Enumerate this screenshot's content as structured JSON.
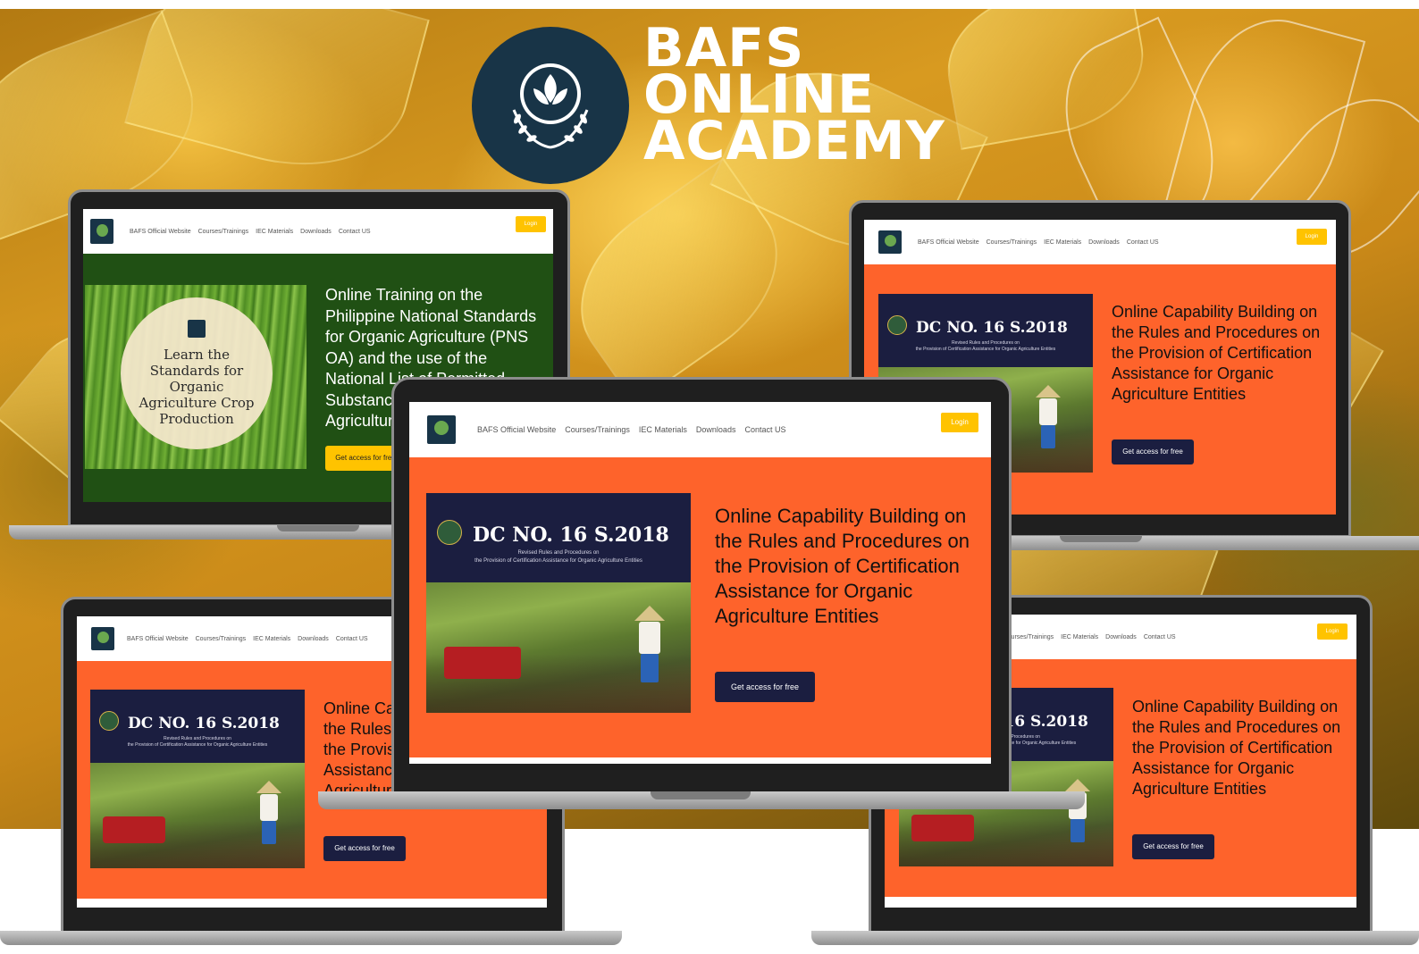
{
  "brand": {
    "line1": "BAFS",
    "line2": "ONLINE",
    "line3": "ACADEMY"
  },
  "nav": {
    "official": "BAFS Official Website",
    "courses": "Courses/Trainings",
    "iec": "IEC Materials",
    "downloads": "Downloads",
    "contact": "Contact US",
    "login": "Login"
  },
  "organic": {
    "title": "Online Training on the Philippine National Standards for Organic Agriculture (PNS OA) and the use of the National List of Permitted Substances for Organic Agriculture",
    "circle": "Learn the Standards for Organic Agriculture Crop Production",
    "cta": "Get access for free"
  },
  "dc": {
    "poster_title": "DC NO. 16 S.2018",
    "poster_sub1": "Revised Rules and Procedures on",
    "poster_sub2": "the Provision of Certification Assistance for Organic Agriculture Entities",
    "title": "Online Capability Building on the Rules and Procedures on the Provision of Certification Assistance for Organic Agriculture Entities",
    "cta": "Get access for free"
  },
  "colors": {
    "orange": "#fe632b",
    "green": "#205014",
    "navy": "#1b1e40",
    "yellow": "#ffc300"
  }
}
